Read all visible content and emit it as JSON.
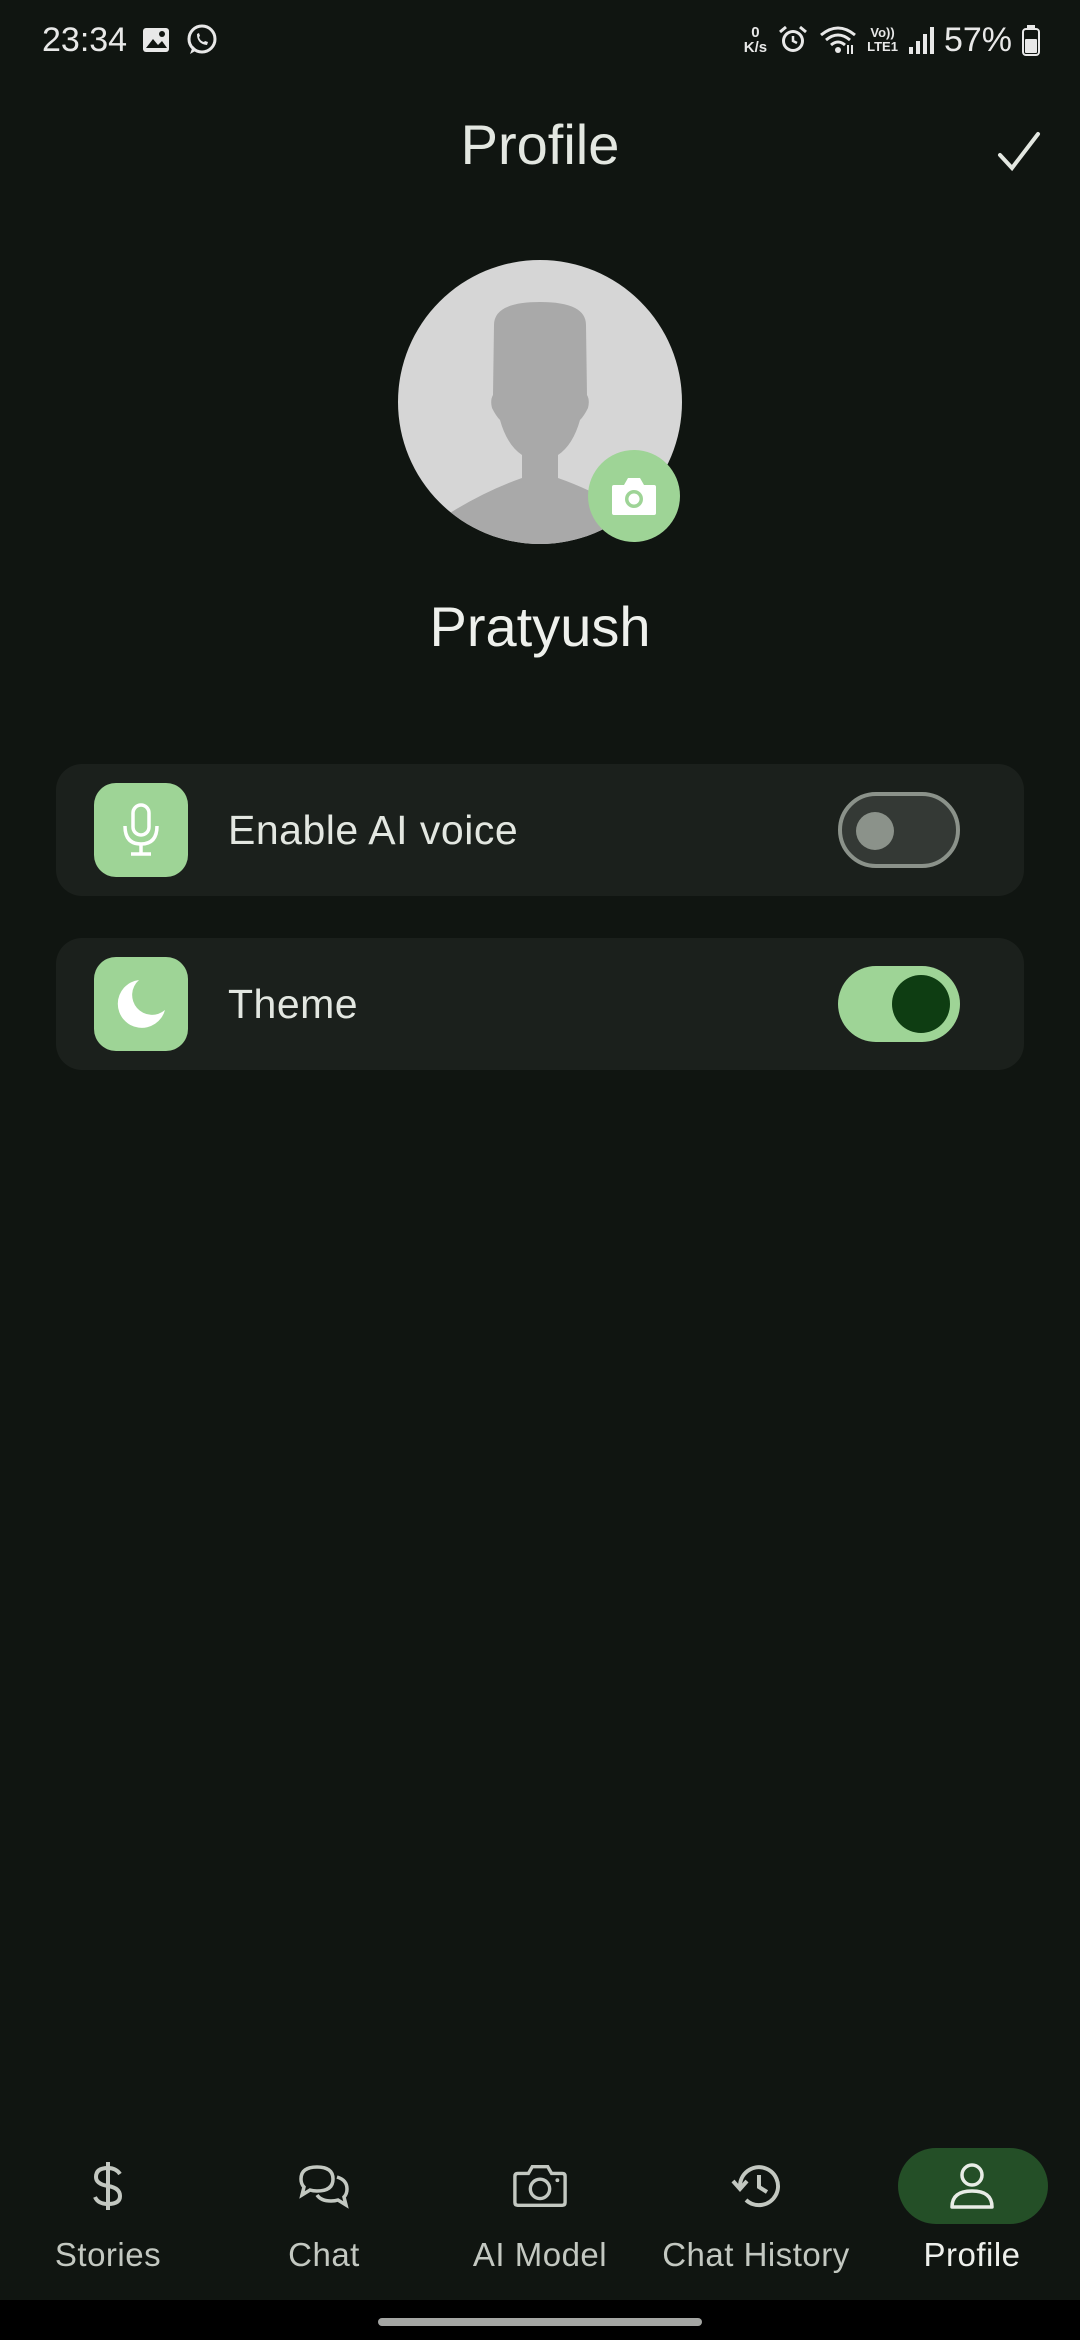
{
  "status_bar": {
    "time": "23:34",
    "net_speed_value": "0",
    "net_speed_unit": "K/s",
    "lte_top": "Vo))",
    "lte_bottom": "LTE1",
    "battery": "57%",
    "icons": [
      "gallery-icon",
      "whatsapp-icon",
      "alarm-icon",
      "wifi-icon",
      "signal-icon",
      "battery-icon"
    ]
  },
  "header": {
    "title": "Profile",
    "confirm_icon": "check-icon"
  },
  "profile": {
    "name": "Pratyush",
    "avatar_icon": "person-silhouette-icon",
    "edit_photo_icon": "camera-icon"
  },
  "settings": [
    {
      "label": "Enable AI voice",
      "icon": "microphone-icon",
      "enabled": false
    },
    {
      "label": "Theme",
      "icon": "moon-icon",
      "enabled": true
    }
  ],
  "nav": {
    "items": [
      {
        "label": "Stories",
        "icon": "dollar-icon",
        "active": false
      },
      {
        "label": "Chat",
        "icon": "chat-bubbles-icon",
        "active": false
      },
      {
        "label": "AI Model",
        "icon": "camera-icon",
        "active": false
      },
      {
        "label": "Chat History",
        "icon": "history-icon",
        "active": false
      },
      {
        "label": "Profile",
        "icon": "person-icon",
        "active": true
      }
    ]
  },
  "colors": {
    "background": "#101511",
    "card": "#1b201c",
    "accent": "#9ed496",
    "active_pill": "#244f27",
    "toggle_knob_on": "#0e3d12"
  }
}
